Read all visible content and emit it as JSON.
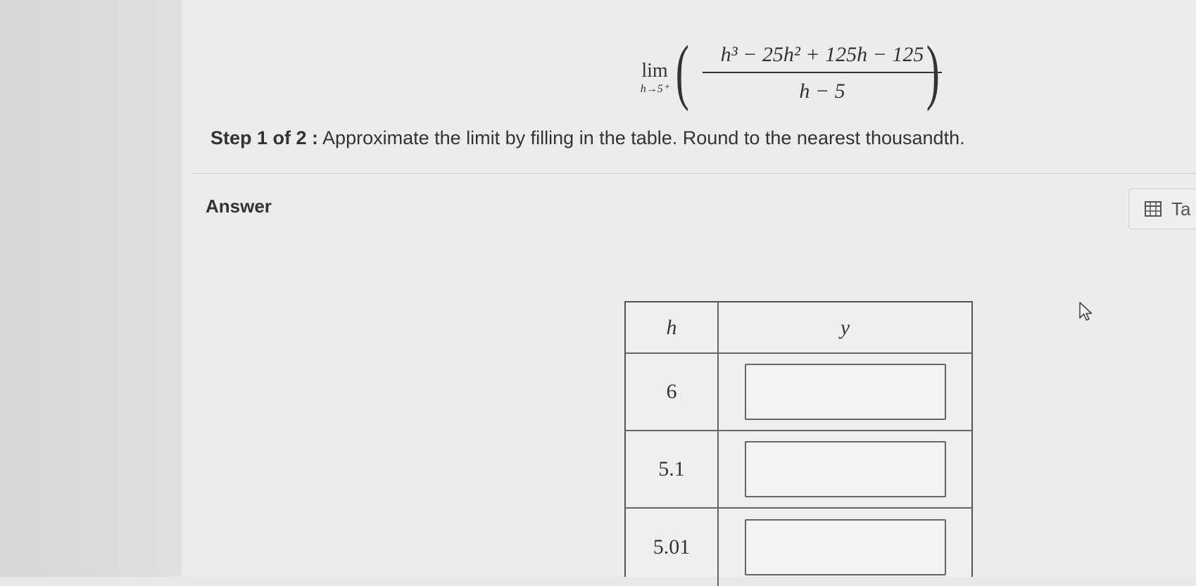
{
  "problem": {
    "lim_word": "lim",
    "lim_subscript": "h→5⁺",
    "numerator": "h³ − 25h² + 125h − 125",
    "denominator": "h − 5"
  },
  "step": {
    "label": "Step 1 of 2 :",
    "instruction": "Approximate the limit by filling in the table. Round to the nearest thousandth."
  },
  "answer": {
    "label": "Answer"
  },
  "toolbar": {
    "table_button_label": "Ta"
  },
  "table": {
    "headers": [
      "h",
      "y"
    ],
    "rows": [
      {
        "h": "6",
        "y": ""
      },
      {
        "h": "5.1",
        "y": ""
      },
      {
        "h": "5.01",
        "y": ""
      }
    ]
  }
}
